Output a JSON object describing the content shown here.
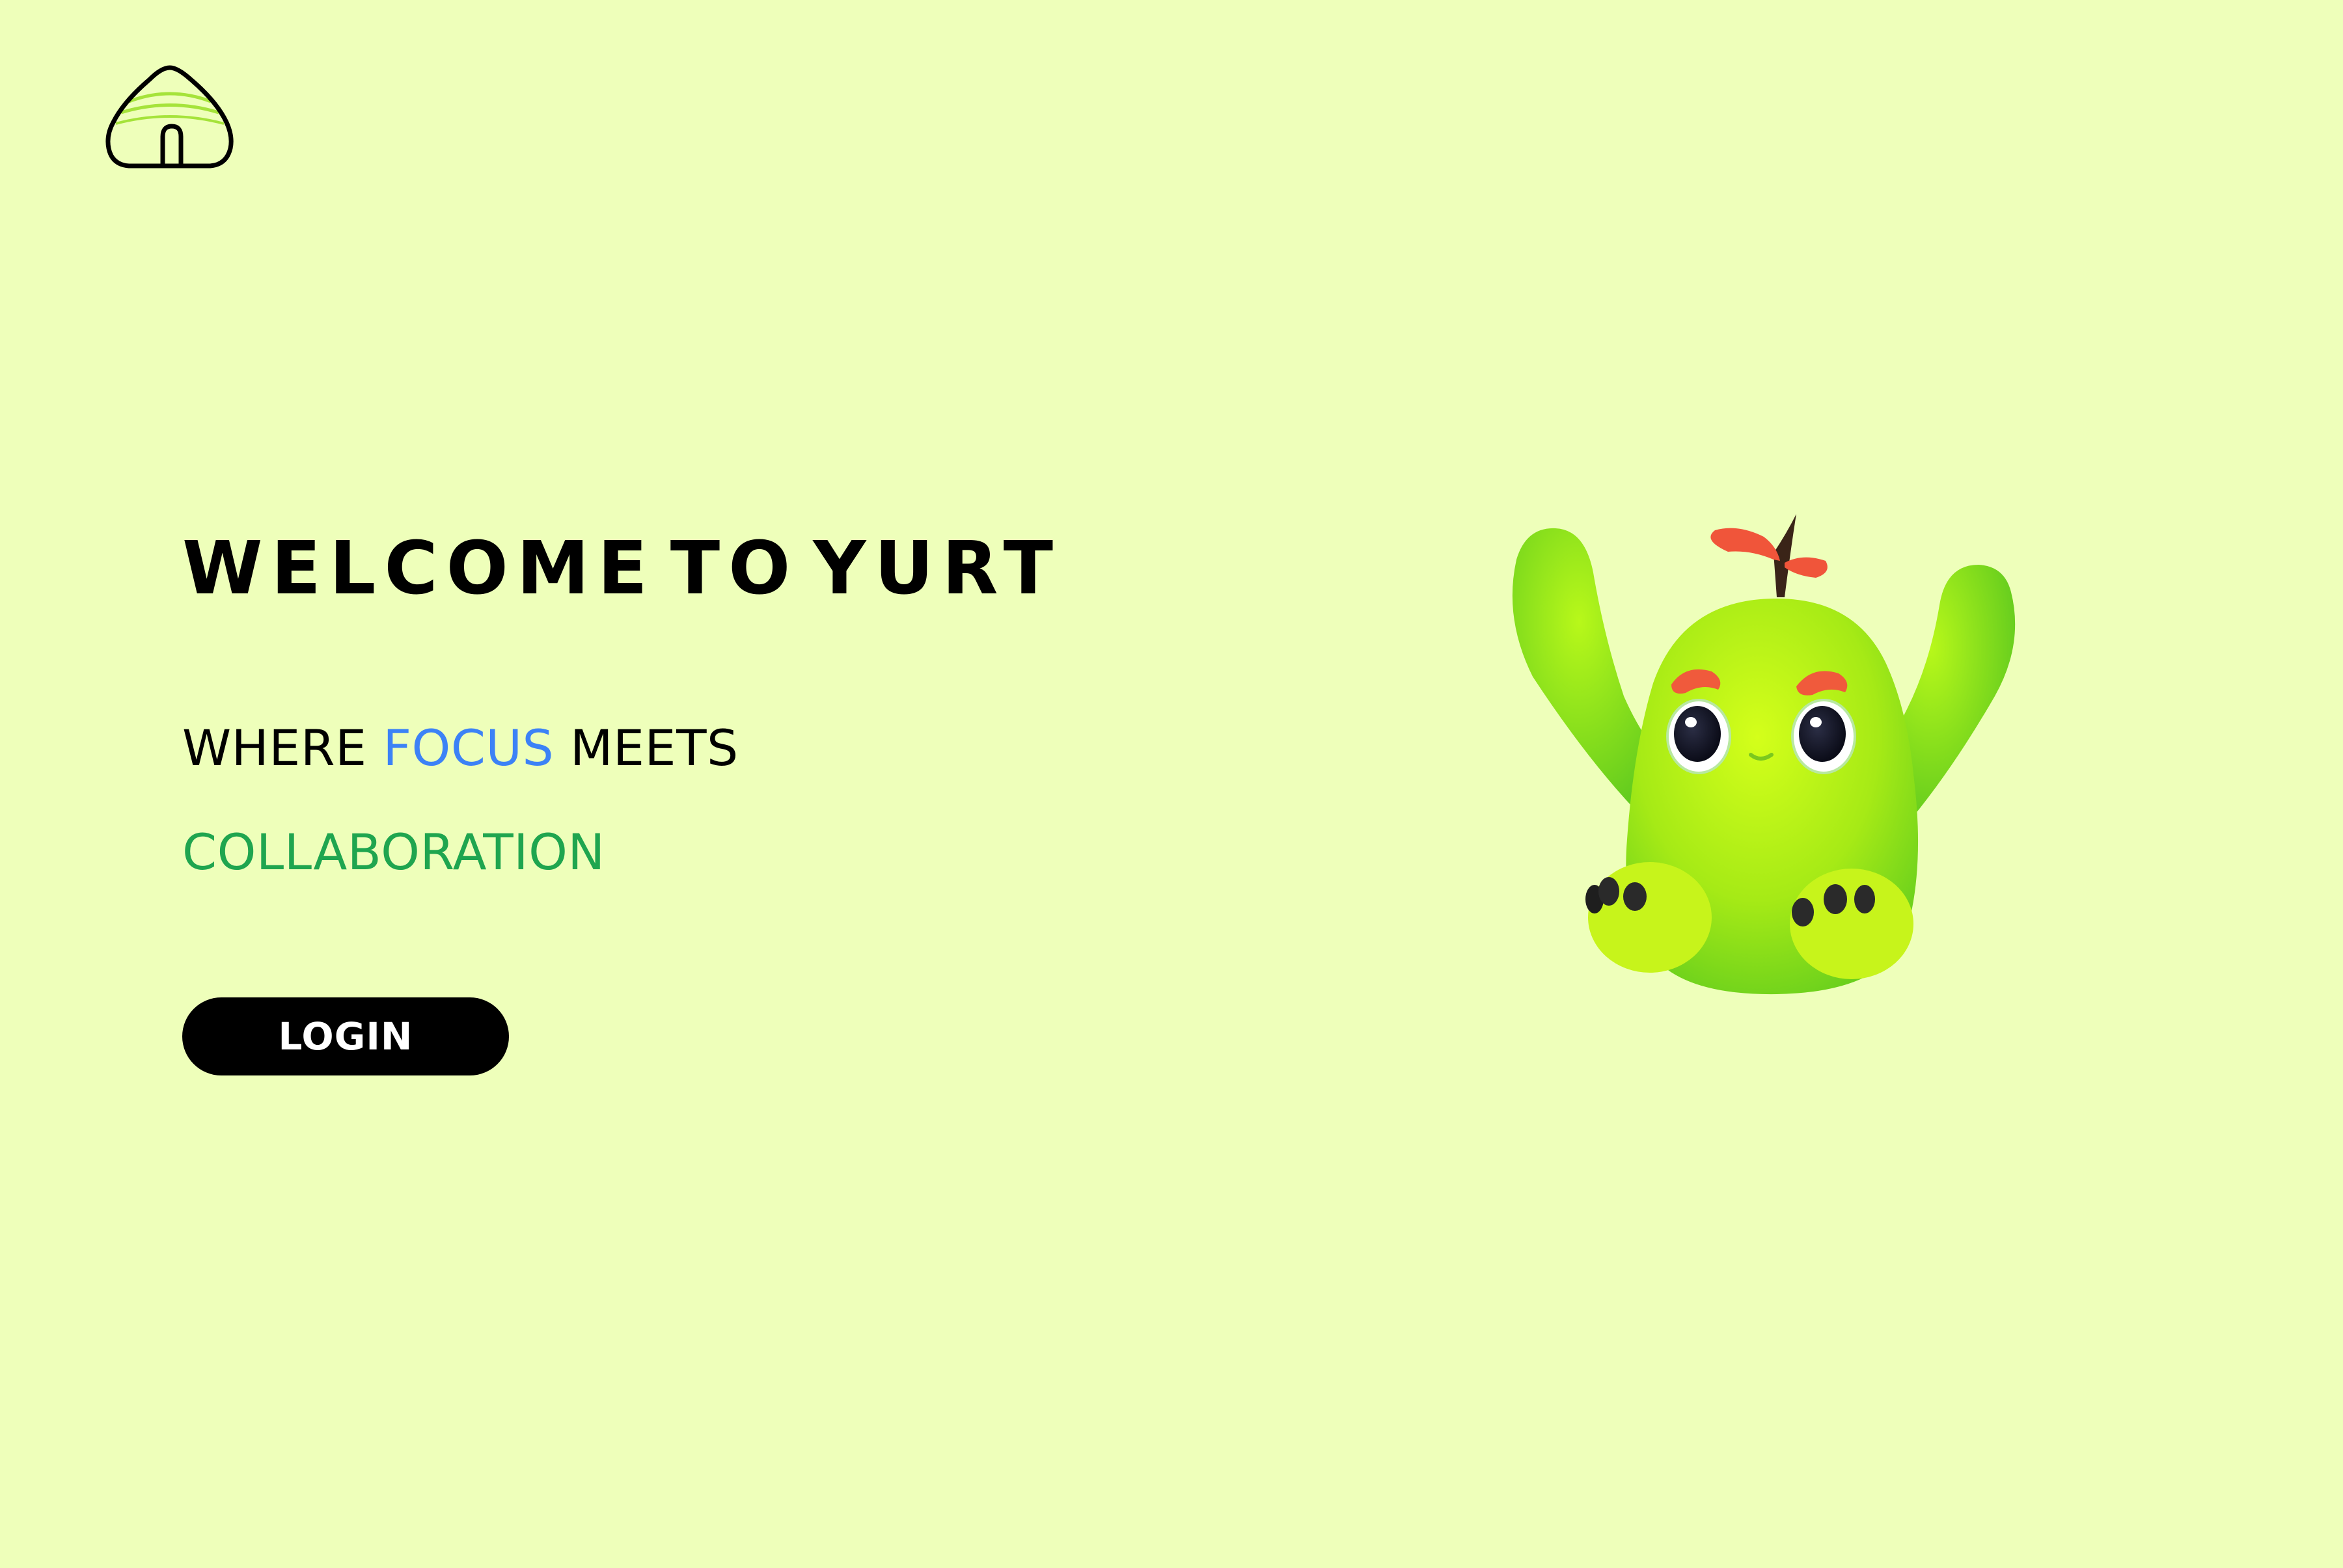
{
  "header": {
    "logo_icon": "yurt-icon"
  },
  "hero": {
    "title": "WELCOME TO YURT",
    "tagline_part1": "WHERE ",
    "tagline_accent": "FOCUS",
    "tagline_part2": " MEETS",
    "tagline_line2": "COLLABORATION",
    "login_label": "LOGIN",
    "mascot_icon": "green-monster-mascot"
  },
  "colors": {
    "background": "#EEFFBA",
    "accent_blue": "#3C82F6",
    "accent_green": "#1FA54F",
    "button_bg": "#000000",
    "button_text": "#FFFFFF",
    "mascot_body": "#9CE619",
    "mascot_brow": "#F05A3C"
  }
}
